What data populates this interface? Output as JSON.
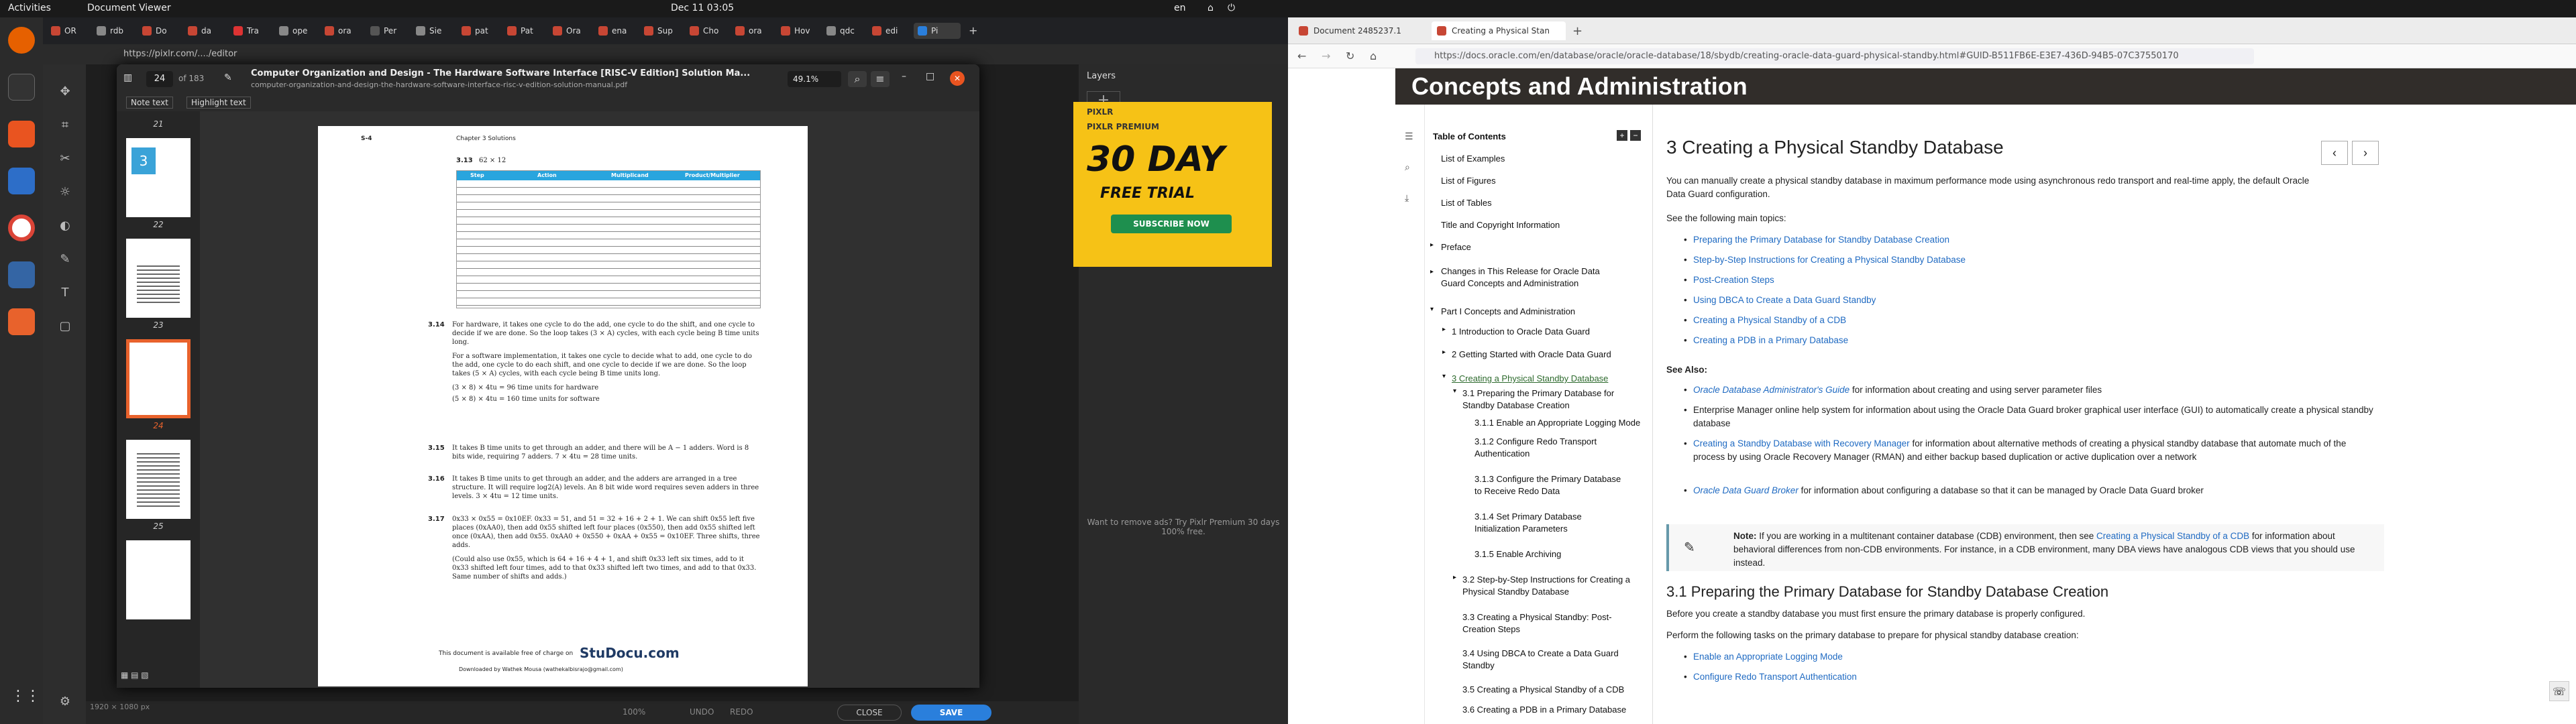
{
  "system": {
    "activities": "Activities",
    "app_name": "Document Viewer",
    "clock": "Dec 11  03:05",
    "lang": "en"
  },
  "left_browser": {
    "tabs": [
      "OR",
      "rdb",
      "Do",
      "da",
      "Tra",
      "ope",
      "ora",
      "Per",
      "Sie",
      "pat",
      "Pat",
      "Ora",
      "ena",
      "Sup",
      "Cho",
      "ora",
      "Hov",
      "qdc",
      "edi",
      "Pi"
    ],
    "url": "https://pixlr.com/..../editor"
  },
  "pdf": {
    "page_current": "24",
    "page_total": "of 183",
    "title": "Computer Organization and Design - The Hardware Software Interface [RISC-V Edition] Solution Ma...",
    "subtitle": "computer-organization-and-design-the-hardware-software-interface-risc-v-edition-solution-manual.pdf",
    "zoom": "49.1%",
    "note_text": "Note text",
    "highlight_text": "Highlight text",
    "thumbs": [
      "21",
      "22",
      "23",
      "24",
      "25"
    ],
    "page_header_left": "S-4",
    "page_header_mid": "Chapter 3    Solutions",
    "problem_313": "3.13",
    "problem_313_text": "62 × 12",
    "table_headers": [
      "Step",
      "Action",
      "Multiplicand",
      "Product/Multiplier"
    ],
    "p314_num": "3.14",
    "p314_text": "For hardware, it takes one cycle to do the add, one cycle to do the shift, and one cycle to decide if we are done. So the loop takes (3 × A) cycles, with each cycle being B time units long.",
    "p314_text2": "For a software implementation, it takes one cycle to decide what to add, one cycle to do the add, one cycle to do each shift, and one cycle to decide if we are done. So the loop takes (5 × A) cycles, with each cycle being B time units long.",
    "p314_eq1": "(3 × 8) × 4tu = 96 time units for hardware",
    "p314_eq2": "(5 × 8) × 4tu = 160 time units for software",
    "p315_num": "3.15",
    "p315_text": "It takes B time units to get through an adder, and there will be A − 1 adders. Word is 8 bits wide, requiring 7 adders. 7 × 4tu = 28 time units.",
    "p316_num": "3.16",
    "p316_text": "It takes B time units to get through an adder, and the adders are arranged in a tree structure. It will require log2(A) levels. An 8 bit wide word requires seven adders in three levels. 3 × 4tu = 12 time units.",
    "p317_num": "3.17",
    "p317_text": "0x33 × 0x55 = 0x10EF. 0x33 = 51, and 51 = 32 + 16 + 2 + 1. We can shift 0x55 left five places (0xAA0), then add 0x55 shifted left four places (0x550), then add 0x55 shifted left once (0xAA), then add 0x55. 0xAA0 + 0x550 + 0xAA + 0x55 = 0x10EF. Three shifts, three adds.",
    "p317_text2": "(Could also use 0x55, which is 64 + 16 + 4 + 1, and shift 0x33 left six times, add to it 0x33 shifted left four times, add to that 0x33 shifted left two times, and add to that 0x33. Same number of shifts and adds.)",
    "footer_avail": "This document is available free of charge on",
    "footer_brand": "StuDocu.com",
    "footer_dl": "Downloaded by Wathek Mousa (wathekalbisrajo@gmail.com)"
  },
  "pixlr": {
    "layers_label": "Layers",
    "ad_brand": "PIXLR",
    "ad_premium": "PIXLR PREMIUM",
    "ad_days": "30 DAY",
    "ad_trial": "FREE TRIAL",
    "ad_button": "SUBSCRIBE NOW",
    "remove_ads": "Want to remove ads? Try Pixlr Premium 30 days 100% free.",
    "zoom": "100%",
    "undo": "UNDO",
    "redo": "REDO",
    "close": "CLOSE",
    "save": "SAVE",
    "size": "1920 × 1080 px"
  },
  "right_browser": {
    "tab1": "Document 2485237.1",
    "tab2": "Creating a Physical Stan",
    "url": "https://docs.oracle.com/en/database/oracle/oracle-database/18/sbydb/creating-oracle-data-guard-physical-standby.html#GUID-B511FB6E-E3E7-436D-94B5-07C37550170",
    "banner": "Concepts and Administration",
    "toc_title": "Table of Contents",
    "toc": [
      "List of Examples",
      "List of Figures",
      "List of Tables",
      "Title and Copyright Information",
      "Preface",
      "Changes in This Release for Oracle Data Guard Concepts and Administration",
      "Part I Concepts and Administration",
      "1 Introduction to Oracle Data Guard",
      "2 Getting Started with Oracle Data Guard",
      "3 Creating a Physical Standby Database",
      "3.1 Preparing the Primary Database for Standby Database Creation",
      "3.1.1 Enable an Appropriate Logging Mode",
      "3.1.2 Configure Redo Transport Authentication",
      "3.1.3 Configure the Primary Database to Receive Redo Data",
      "3.1.4 Set Primary Database Initialization Parameters",
      "3.1.5 Enable Archiving",
      "3.2 Step-by-Step Instructions for Creating a Physical Standby Database",
      "3.3 Creating a Physical Standby: Post-Creation Steps",
      "3.4 Using DBCA to Create a Data Guard Standby",
      "3.5 Creating a Physical Standby of a CDB",
      "3.6 Creating a PDB in a Primary Database"
    ],
    "h1": "3  Creating a Physical Standby Database",
    "intro": "You can manually create a physical standby database in maximum performance mode using asynchronous redo transport and real-time apply, the default Oracle Data Guard configuration.",
    "main_topics_label": "See the following main topics:",
    "topics": [
      "Preparing the Primary Database for Standby Database Creation",
      "Step-by-Step Instructions for Creating a Physical Standby Database",
      "Post-Creation Steps",
      "Using DBCA to Create a Data Guard Standby",
      "Creating a Physical Standby of a CDB",
      "Creating a PDB in a Primary Database"
    ],
    "see_also": "See Also:",
    "sa1_link": "Oracle Database Administrator's Guide",
    "sa1_text": " for information about creating and using server parameter files",
    "sa2_text": "Enterprise Manager online help system for information about using the Oracle Data Guard broker graphical user interface (GUI) to automatically create a physical standby database",
    "sa3_link": "Creating a Standby Database with Recovery Manager",
    "sa3_text": " for information about alternative methods of creating a physical standby database that automate much of the process by using Oracle Recovery Manager (RMAN) and either backup based duplication or active duplication over a network",
    "sa4_link": "Oracle Data Guard Broker",
    "sa4_text": " for information about configuring a database so that it can be managed by Oracle Data Guard broker",
    "note_label": "Note:",
    "note_text1": " If you are working in a multitenant container database (CDB) environment, then see ",
    "note_link": "Creating a Physical Standby of a CDB",
    "note_text2": " for information about behavioral differences from non-CDB environments. For instance, in a CDB environment, many DBA views have analogous CDB views that you should use instead.",
    "h2": "3.1 Preparing the Primary Database for Standby Database Creation",
    "p_before": "Before you create a standby database you must first ensure the primary database is properly configured.",
    "p_perform": "Perform the following tasks on the primary database to prepare for physical standby database creation:",
    "tasks": [
      "Enable an Appropriate Logging Mode",
      "Configure Redo Transport Authentication"
    ]
  }
}
